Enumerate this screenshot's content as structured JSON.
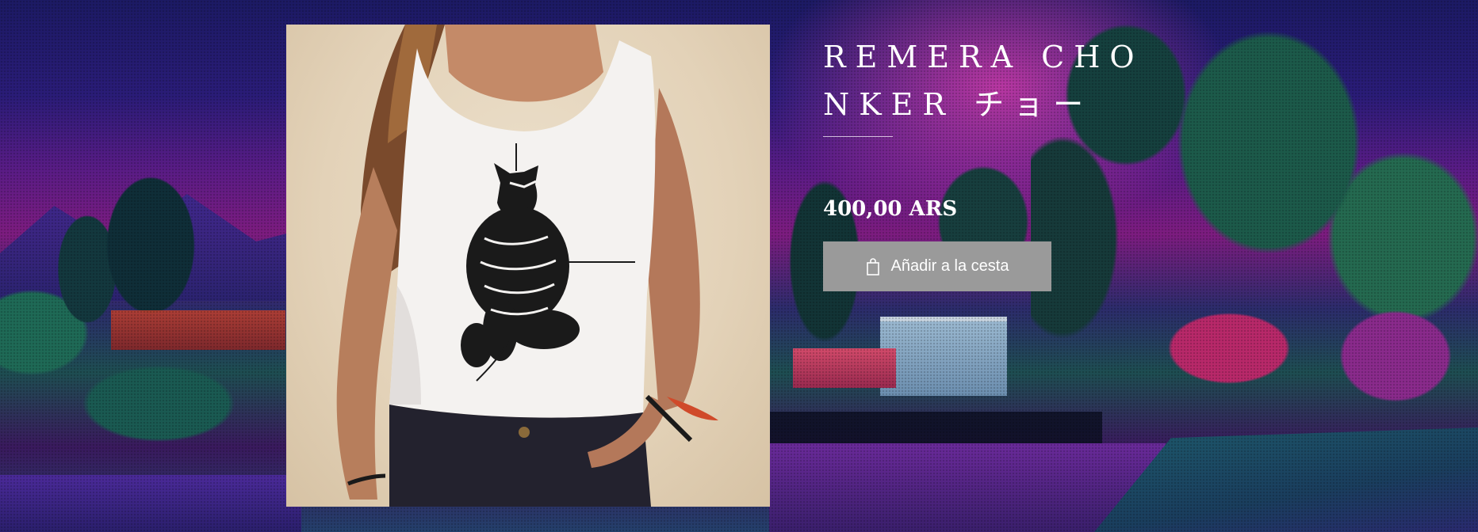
{
  "product": {
    "title": "REMERA CHONKER チョー",
    "price": "400,00 ARS",
    "image_alt": "Remera blanca con ilustración de gato",
    "add_to_cart_label": "Añadir a la cesta",
    "add_to_cart_icon": "shopping-bag-icon"
  },
  "colors": {
    "button_bg": "#9a9a9a",
    "text": "#ffffff",
    "background_theme": "pixel-art-night-landscape"
  }
}
